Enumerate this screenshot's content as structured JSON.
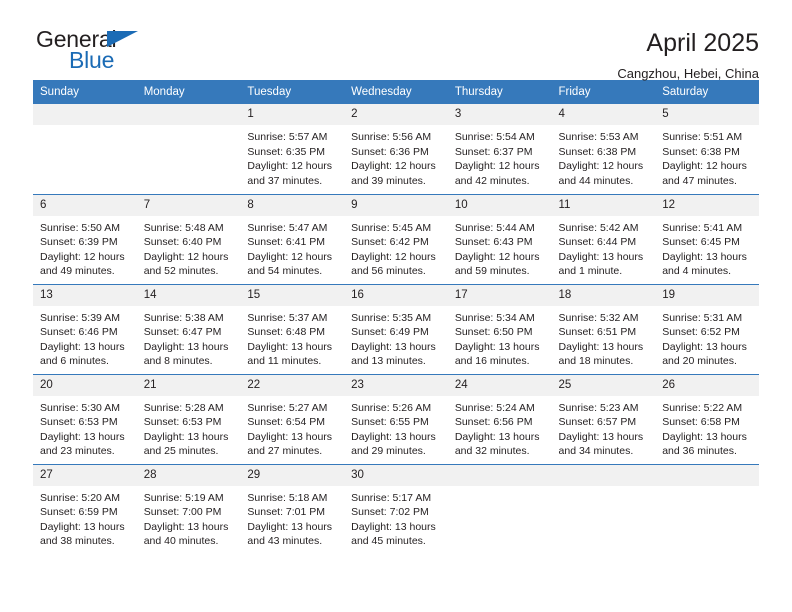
{
  "brand": {
    "name_part1": "General",
    "name_part2": "Blue",
    "flag_icon": "triangle-flag-icon"
  },
  "header": {
    "title": "April 2025",
    "subtitle": "Cangzhou, Hebei, China"
  },
  "calendar": {
    "weekday_headers": [
      "Sunday",
      "Monday",
      "Tuesday",
      "Wednesday",
      "Thursday",
      "Friday",
      "Saturday"
    ],
    "accent_color": "#3679bb",
    "daynum_band_color": "#f1f1f1",
    "weeks": [
      [
        {
          "day": "",
          "lines": []
        },
        {
          "day": "",
          "lines": []
        },
        {
          "day": "1",
          "lines": [
            "Sunrise: 5:57 AM",
            "Sunset: 6:35 PM",
            "Daylight: 12 hours",
            "and 37 minutes."
          ]
        },
        {
          "day": "2",
          "lines": [
            "Sunrise: 5:56 AM",
            "Sunset: 6:36 PM",
            "Daylight: 12 hours",
            "and 39 minutes."
          ]
        },
        {
          "day": "3",
          "lines": [
            "Sunrise: 5:54 AM",
            "Sunset: 6:37 PM",
            "Daylight: 12 hours",
            "and 42 minutes."
          ]
        },
        {
          "day": "4",
          "lines": [
            "Sunrise: 5:53 AM",
            "Sunset: 6:38 PM",
            "Daylight: 12 hours",
            "and 44 minutes."
          ]
        },
        {
          "day": "5",
          "lines": [
            "Sunrise: 5:51 AM",
            "Sunset: 6:38 PM",
            "Daylight: 12 hours",
            "and 47 minutes."
          ]
        }
      ],
      [
        {
          "day": "6",
          "lines": [
            "Sunrise: 5:50 AM",
            "Sunset: 6:39 PM",
            "Daylight: 12 hours",
            "and 49 minutes."
          ]
        },
        {
          "day": "7",
          "lines": [
            "Sunrise: 5:48 AM",
            "Sunset: 6:40 PM",
            "Daylight: 12 hours",
            "and 52 minutes."
          ]
        },
        {
          "day": "8",
          "lines": [
            "Sunrise: 5:47 AM",
            "Sunset: 6:41 PM",
            "Daylight: 12 hours",
            "and 54 minutes."
          ]
        },
        {
          "day": "9",
          "lines": [
            "Sunrise: 5:45 AM",
            "Sunset: 6:42 PM",
            "Daylight: 12 hours",
            "and 56 minutes."
          ]
        },
        {
          "day": "10",
          "lines": [
            "Sunrise: 5:44 AM",
            "Sunset: 6:43 PM",
            "Daylight: 12 hours",
            "and 59 minutes."
          ]
        },
        {
          "day": "11",
          "lines": [
            "Sunrise: 5:42 AM",
            "Sunset: 6:44 PM",
            "Daylight: 13 hours",
            "and 1 minute."
          ]
        },
        {
          "day": "12",
          "lines": [
            "Sunrise: 5:41 AM",
            "Sunset: 6:45 PM",
            "Daylight: 13 hours",
            "and 4 minutes."
          ]
        }
      ],
      [
        {
          "day": "13",
          "lines": [
            "Sunrise: 5:39 AM",
            "Sunset: 6:46 PM",
            "Daylight: 13 hours",
            "and 6 minutes."
          ]
        },
        {
          "day": "14",
          "lines": [
            "Sunrise: 5:38 AM",
            "Sunset: 6:47 PM",
            "Daylight: 13 hours",
            "and 8 minutes."
          ]
        },
        {
          "day": "15",
          "lines": [
            "Sunrise: 5:37 AM",
            "Sunset: 6:48 PM",
            "Daylight: 13 hours",
            "and 11 minutes."
          ]
        },
        {
          "day": "16",
          "lines": [
            "Sunrise: 5:35 AM",
            "Sunset: 6:49 PM",
            "Daylight: 13 hours",
            "and 13 minutes."
          ]
        },
        {
          "day": "17",
          "lines": [
            "Sunrise: 5:34 AM",
            "Sunset: 6:50 PM",
            "Daylight: 13 hours",
            "and 16 minutes."
          ]
        },
        {
          "day": "18",
          "lines": [
            "Sunrise: 5:32 AM",
            "Sunset: 6:51 PM",
            "Daylight: 13 hours",
            "and 18 minutes."
          ]
        },
        {
          "day": "19",
          "lines": [
            "Sunrise: 5:31 AM",
            "Sunset: 6:52 PM",
            "Daylight: 13 hours",
            "and 20 minutes."
          ]
        }
      ],
      [
        {
          "day": "20",
          "lines": [
            "Sunrise: 5:30 AM",
            "Sunset: 6:53 PM",
            "Daylight: 13 hours",
            "and 23 minutes."
          ]
        },
        {
          "day": "21",
          "lines": [
            "Sunrise: 5:28 AM",
            "Sunset: 6:53 PM",
            "Daylight: 13 hours",
            "and 25 minutes."
          ]
        },
        {
          "day": "22",
          "lines": [
            "Sunrise: 5:27 AM",
            "Sunset: 6:54 PM",
            "Daylight: 13 hours",
            "and 27 minutes."
          ]
        },
        {
          "day": "23",
          "lines": [
            "Sunrise: 5:26 AM",
            "Sunset: 6:55 PM",
            "Daylight: 13 hours",
            "and 29 minutes."
          ]
        },
        {
          "day": "24",
          "lines": [
            "Sunrise: 5:24 AM",
            "Sunset: 6:56 PM",
            "Daylight: 13 hours",
            "and 32 minutes."
          ]
        },
        {
          "day": "25",
          "lines": [
            "Sunrise: 5:23 AM",
            "Sunset: 6:57 PM",
            "Daylight: 13 hours",
            "and 34 minutes."
          ]
        },
        {
          "day": "26",
          "lines": [
            "Sunrise: 5:22 AM",
            "Sunset: 6:58 PM",
            "Daylight: 13 hours",
            "and 36 minutes."
          ]
        }
      ],
      [
        {
          "day": "27",
          "lines": [
            "Sunrise: 5:20 AM",
            "Sunset: 6:59 PM",
            "Daylight: 13 hours",
            "and 38 minutes."
          ]
        },
        {
          "day": "28",
          "lines": [
            "Sunrise: 5:19 AM",
            "Sunset: 7:00 PM",
            "Daylight: 13 hours",
            "and 40 minutes."
          ]
        },
        {
          "day": "29",
          "lines": [
            "Sunrise: 5:18 AM",
            "Sunset: 7:01 PM",
            "Daylight: 13 hours",
            "and 43 minutes."
          ]
        },
        {
          "day": "30",
          "lines": [
            "Sunrise: 5:17 AM",
            "Sunset: 7:02 PM",
            "Daylight: 13 hours",
            "and 45 minutes."
          ]
        },
        {
          "day": "",
          "lines": []
        },
        {
          "day": "",
          "lines": []
        },
        {
          "day": "",
          "lines": []
        }
      ]
    ]
  }
}
